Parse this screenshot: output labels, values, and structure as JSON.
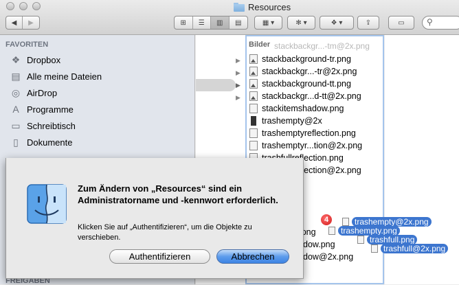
{
  "window": {
    "title": "Resources"
  },
  "toolbar": {
    "back_icon": "chevron-left-icon",
    "forward_icon": "chevron-right-icon",
    "view_modes": [
      "icon-view",
      "list-view",
      "column-view",
      "cover-flow-view"
    ],
    "active_view": "column-view"
  },
  "sidebar": {
    "section_favorites": "FAVORITEN",
    "section_shared": "FREIGABEN",
    "items": [
      {
        "label": "Dropbox",
        "icon": "dropbox-icon"
      },
      {
        "label": "Alle meine Dateien",
        "icon": "all-files-icon"
      },
      {
        "label": "AirDrop",
        "icon": "airdrop-icon"
      },
      {
        "label": "Programme",
        "icon": "applications-icon"
      },
      {
        "label": "Schreibtisch",
        "icon": "desktop-icon"
      },
      {
        "label": "Dokumente",
        "icon": "documents-icon"
      }
    ]
  },
  "column": {
    "header": "Bilder",
    "ghost": "stackbackgr...-tm@2x.png",
    "files": [
      "stackbackground-tr.png",
      "stackbackgr...-tr@2x.png",
      "stackbackground-tt.png",
      "stackbackgr...d-tt@2x.png",
      "stackitemshadow.png",
      "trashempty@2x",
      "trashemptyreflection.png",
      "trashemptyr...tion@2x.png",
      "trashfullreflection.png",
      "trashfullreflection@2x.png"
    ],
    "partial_files": [
      "x.png",
      "dow.png",
      "dow@2x.png"
    ]
  },
  "drag": {
    "count": "4",
    "items": [
      "trashempty@2x.png",
      "trashempty.png",
      "trashfull.png",
      "trashfull@2x.png"
    ]
  },
  "dialog": {
    "title": "Zum Ändern von „Resources“ sind ein Administratorname und -kennwort erforderlich.",
    "message": "Klicken Sie auf „Authentifizieren“, um die Objekte zu verschieben.",
    "auth_button": "Authentifizieren",
    "cancel_button": "Abbrechen"
  }
}
